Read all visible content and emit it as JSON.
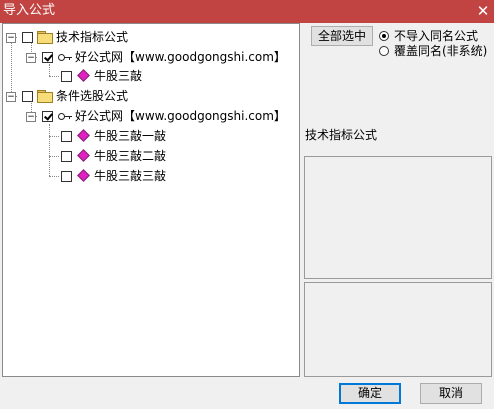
{
  "window": {
    "title": "导入公式",
    "close_glyph": "✕"
  },
  "tree": {
    "group1": {
      "label": "技术指标公式",
      "source": {
        "label": "好公式网【www.goodgongshi.com】",
        "checked": true
      },
      "items": [
        "牛股三敲"
      ]
    },
    "group2": {
      "label": "条件选股公式",
      "source": {
        "label": "好公式网【www.goodgongshi.com】",
        "checked": true
      },
      "items": [
        "牛股三敲一敲",
        "牛股三敲二敲",
        "牛股三敲三敲"
      ]
    },
    "expander_glyph": "−"
  },
  "controls": {
    "select_all_label": "全部选中",
    "options": [
      {
        "label": "不导入同名公式",
        "selected": true
      },
      {
        "label": "覆盖同名(非系统)",
        "selected": false
      }
    ]
  },
  "info_panel": {
    "heading": "技术指标公式"
  },
  "footer": {
    "ok_label": "确定",
    "cancel_label": "取消"
  },
  "colors": {
    "titlebar": "#c24442",
    "folder": "#f6dd7a",
    "formula_diamond": "#e020c0"
  },
  "icons": [
    "folder-icon",
    "key-icon",
    "diamond-icon",
    "close-icon"
  ]
}
